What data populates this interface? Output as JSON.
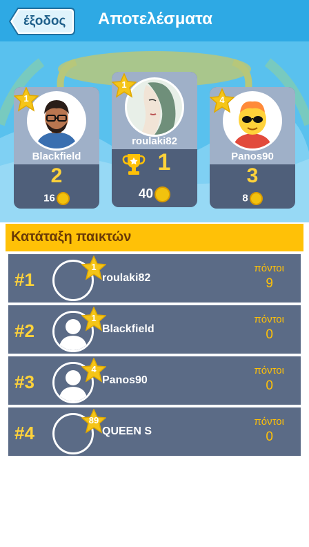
{
  "header": {
    "exit_label": "έξοδος",
    "title": "Αποτελέσματα"
  },
  "podium": [
    {
      "name": "Blackfield",
      "level": "1",
      "rank": "2",
      "coins": "16",
      "avatar": "man-glasses-beard"
    },
    {
      "name": "roulaki82",
      "level": "1",
      "rank": "1",
      "coins": "40",
      "avatar": "woman-portrait"
    },
    {
      "name": "Panos90",
      "level": "4",
      "rank": "3",
      "coins": "8",
      "avatar": "emoji-sunglasses"
    }
  ],
  "ranking": {
    "title": "Κατάταξη παικτών",
    "points_label": "πόντοι",
    "rows": [
      {
        "position": "#1",
        "name": "roulaki82",
        "level": "1",
        "points": "9",
        "avatar": "empty"
      },
      {
        "position": "#2",
        "name": "Blackfield",
        "level": "1",
        "points": "0",
        "avatar": "silhouette"
      },
      {
        "position": "#3",
        "name": "Panos90",
        "level": "4",
        "points": "0",
        "avatar": "silhouette"
      },
      {
        "position": "#4",
        "name": "QUEEN S",
        "level": "89",
        "points": "0",
        "avatar": "empty"
      }
    ]
  },
  "colors": {
    "topbar": "#2ea9e4",
    "accent_yellow": "#ffc107",
    "card_dark": "#4f5f7a",
    "row_bg": "#5b6b86"
  }
}
